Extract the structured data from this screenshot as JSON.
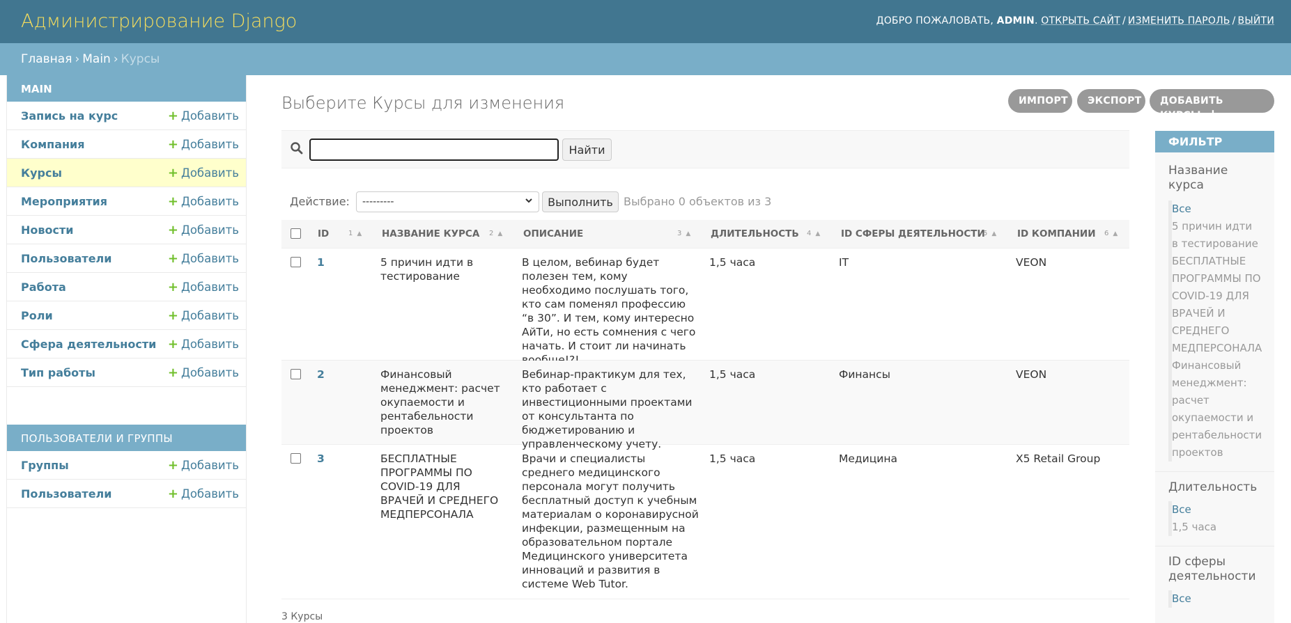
{
  "header": {
    "branding": "Администрирование Django",
    "welcome": "Добро пожаловать,",
    "username": "admin",
    "links": [
      "Открыть сайт",
      "Изменить пароль",
      "Выйти"
    ]
  },
  "breadcrumbs": {
    "home": "Главная",
    "app": "Main",
    "current": "Курсы"
  },
  "sidebar": {
    "main_caption": "MAIN",
    "add_label": "Добавить",
    "items": [
      {
        "label": "Запись на курс"
      },
      {
        "label": "Компания"
      },
      {
        "label": "Курсы"
      },
      {
        "label": "Мероприятия"
      },
      {
        "label": "Новости"
      },
      {
        "label": "Пользователи"
      },
      {
        "label": "Работа"
      },
      {
        "label": "Роли"
      },
      {
        "label": "Сфера деятельности"
      },
      {
        "label": "Тип работы"
      }
    ],
    "users_caption": "Пользователи и группы",
    "users_items": [
      {
        "label": "Группы"
      },
      {
        "label": "Пользователи"
      }
    ]
  },
  "content": {
    "title": "Выберите Курсы для изменения",
    "tools": {
      "import": "Импорт",
      "export": "Экспорт",
      "add": "Добавить Курсы",
      "add_icon": "+"
    },
    "search": {
      "value": "",
      "submit": "Найти"
    },
    "actions": {
      "label": "Действие:",
      "selected": "---------",
      "go": "Выполнить",
      "counter": "Выбрано 0 объектов из 3"
    },
    "columns": [
      {
        "label": "ID",
        "sort": "1"
      },
      {
        "label": "Название курса",
        "sort": "2"
      },
      {
        "label": "Описание",
        "sort": "3"
      },
      {
        "label": "Длительность",
        "sort": "4"
      },
      {
        "label": "ID сферы деятельности",
        "sort": "5"
      },
      {
        "label": "ID компании",
        "sort": "6"
      }
    ],
    "rows": [
      {
        "id": "1",
        "name": "5 причин идти в тестирование",
        "description": "В целом, вебинар будет полезен тем, кому необходимо послушать того, кто сам поменял профессию “в 30”. И тем, кому интересно АйТи, но есть сомнения с чего начать. И стоит ли начинать вообще!?!",
        "duration": "1,5 часа",
        "sphere": "IT",
        "company": "VEON"
      },
      {
        "id": "2",
        "name": "Финансовый менеджмент: расчет окупаемости и рентабельности проектов",
        "description": "Вебинар-практикум для тех, кто работает с инвестиционными проектами от консультанта по бюджетированию и управленческому учету.",
        "duration": "1,5 часа",
        "sphere": "Финансы",
        "company": "VEON"
      },
      {
        "id": "3",
        "name": "БЕСПЛАТНЫЕ ПРОГРАММЫ ПО COVID-19 ДЛЯ ВРАЧЕЙ И СРЕДНЕГО МЕДПЕРСОНАЛА",
        "description": "Врачи и специалисты среднего медицинского персонала могут получить бесплатный доступ к учебным материалам о коронавирусной инфекции, размещенным на образовательном портале Медицинского университета инноваций и развития в системе Web Tutor.",
        "duration": "1,5 часа",
        "sphere": "Медицина",
        "company": "X5 Retail Group"
      }
    ],
    "paginator": "3 Курсы"
  },
  "filter": {
    "caption": "Фильтр",
    "groups": [
      {
        "title": "Название курса",
        "items": [
          "Все",
          "5 причин идти в тестирование",
          "БЕСПЛАТНЫЕ ПРОГРАММЫ ПО COVID-19 ДЛЯ ВРАЧЕЙ И СРЕДНЕГО МЕДПЕРСОНАЛА",
          "Финансовый менеджмент: расчет окупаемости и рентабельности проектов"
        ]
      },
      {
        "title": "Длительность",
        "items": [
          "Все",
          "1,5 часа"
        ]
      },
      {
        "title": "ID сферы деятельности",
        "items": [
          "Все"
        ]
      }
    ]
  },
  "colors": {
    "header_bg": "#417690",
    "breadcrumbs_bg": "#79aec8",
    "branding": "#f5dd5d",
    "link": "#447e9b",
    "add_plus": "#70bf2b",
    "current_row": "#ffffcc"
  },
  "icons": {
    "search": "search-icon",
    "plus": "plus-icon",
    "sort": "sort-asc-icon"
  }
}
